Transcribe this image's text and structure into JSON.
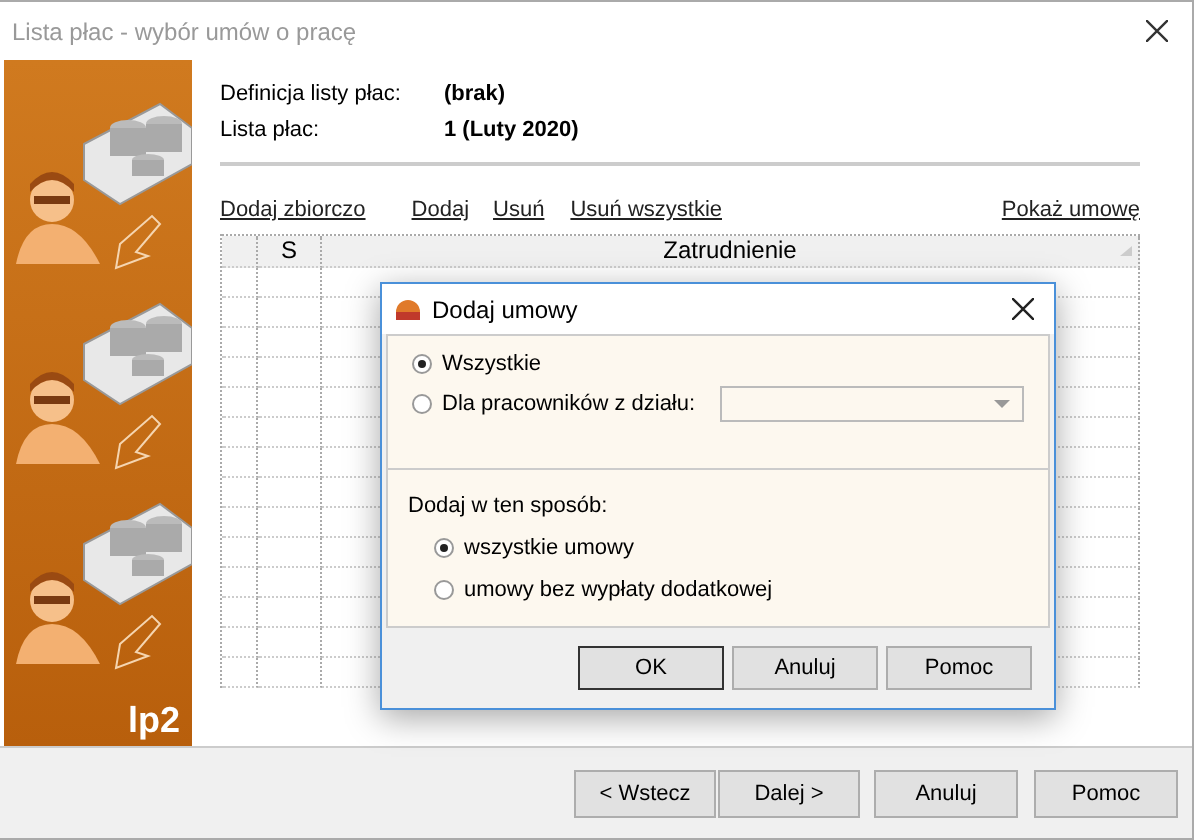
{
  "window": {
    "title": "Lista płac - wybór umów o pracę"
  },
  "banner": {
    "logo": "lp2"
  },
  "header": {
    "fields": [
      {
        "label": "Definicja listy płac:",
        "value": "(brak)"
      },
      {
        "label": "Lista płac:",
        "value": "1 (Luty 2020)"
      }
    ]
  },
  "actions": [
    "Dodaj zbiorczo",
    "Dodaj",
    "Usuń",
    "Usuń wszystkie"
  ],
  "show_link": "Pokaż umowę",
  "table": {
    "columns": [
      "S",
      "Zatrudnienie"
    ]
  },
  "dialog": {
    "title": "Dodaj umowy",
    "scope": [
      {
        "label": "Wszystkie",
        "selected": true
      },
      {
        "label": "Dla pracowników z działu:",
        "selected": false
      }
    ],
    "mode_label": "Dodaj w ten sposób:",
    "modes": [
      {
        "label": "wszystkie umowy",
        "selected": true
      },
      {
        "label": "umowy bez wypłaty dodatkowej",
        "selected": false
      }
    ],
    "buttons": [
      "OK",
      "Anuluj",
      "Pomoc"
    ]
  },
  "footer": {
    "buttons": [
      "< Wstecz",
      "Dalej >",
      "Anuluj",
      "Pomoc"
    ]
  }
}
